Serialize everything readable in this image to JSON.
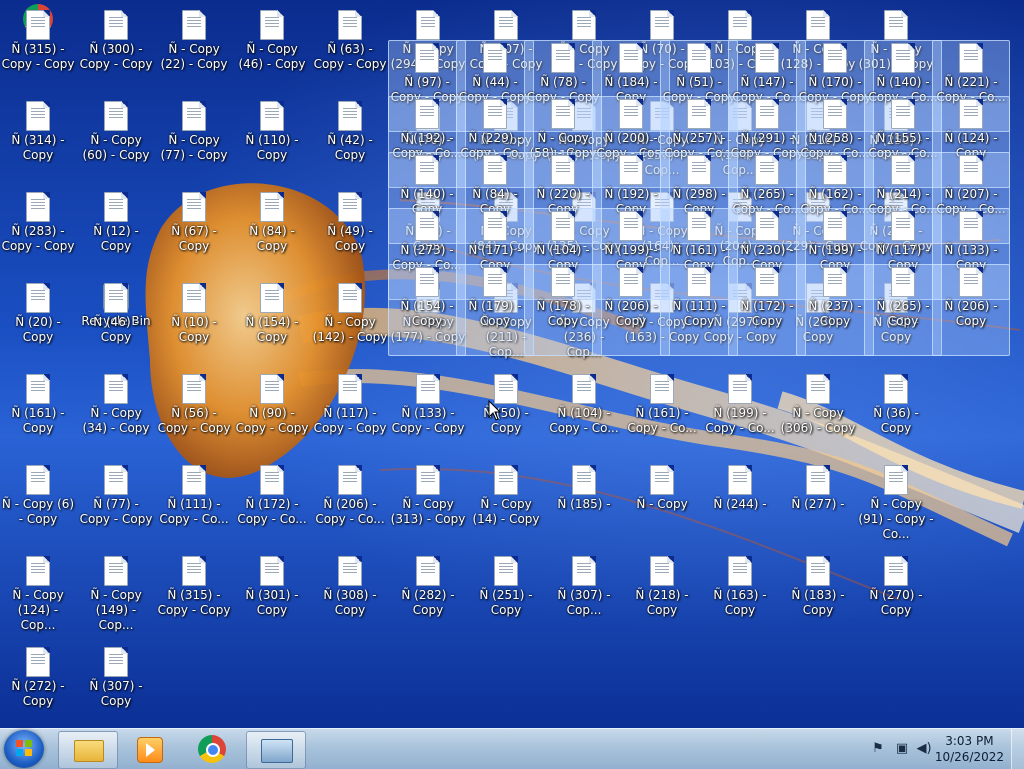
{
  "desktop": {
    "recycle_bin_label": "Recycle Bin",
    "selected_icons": [
      "Ñ (97) - Copy - Copy",
      "Ñ (44) - Copy - Copy",
      "Ñ (78) - Copy - Copy",
      "Ñ (184) - Copy",
      "Ñ (51) - Copy - Copy",
      "Ñ (147) - Copy - Co...",
      "Ñ (170) - Copy - Copy",
      "Ñ (140) - Copy - Co...",
      "Ñ (221) - Copy - Co...",
      "Ñ (192) - Copy - Co...",
      "Ñ (229) - Copy - Co...",
      "Ñ - Copy (58) - Copy",
      "Ñ (200) - Copy - Co...",
      "Ñ (257) - Copy - Co...",
      "Ñ (291) - Copy - Copy",
      "Ñ (258) - Copy - Co...",
      "Ñ (155) - Copy - Co...",
      "Ñ (124) - Copy",
      "Ñ (140) - Copy",
      "Ñ (84) - Copy",
      "Ñ (220) - Copy",
      "Ñ (192) - Copy",
      "Ñ (298) - Copy",
      "Ñ (265) - Copy - Co...",
      "Ñ (162) - Copy - Co...",
      "Ñ (214) - Copy - Co...",
      "Ñ (207) - Copy - Co...",
      "Ñ (273) - Copy - Co...",
      "Ñ (171) - Copy",
      "Ñ (104) - Copy",
      "Ñ (199) - Copy",
      "Ñ (161) - Copy",
      "Ñ (230) - Copy",
      "Ñ (199) - Copy",
      "Ñ (117) - Copy",
      "Ñ (133) - Copy",
      "Ñ (154) - Copy",
      "Ñ (179) - Copy",
      "Ñ (178) - Copy",
      "Ñ (206) - Copy",
      "Ñ (111) - Copy",
      "Ñ (172) - Copy",
      "Ñ (237) - Copy",
      "Ñ (265) - Copy",
      "Ñ (206) - Copy"
    ],
    "icons": [
      "Ñ (315) - Copy - Copy",
      "Ñ (300) - Copy - Copy",
      "Ñ - Copy (22) - Copy",
      "Ñ - Copy (46) - Copy",
      "Ñ (63) - Copy - Copy",
      "Ñ - Copy (294) - Copy",
      "Ñ (307) - Copy - Copy",
      "Ñ - Copy (53) - Copy",
      "Ñ (70) - Copy - Copy",
      "Ñ - Copy (103) - Copy",
      "Ñ - Copy (128) - Copy",
      "Ñ - Copy (301) - Copy",
      "Ñ (314) - Copy",
      "Ñ - Copy (60) - Copy",
      "Ñ - Copy (77) - Copy",
      "Ñ (110) - Copy",
      "Ñ (42) - Copy",
      "Ñ (76) - Copy",
      "Ñ - Copy (77) - Copy",
      "Ñ - Copy (117) - Copy",
      "Ñ - Copy (157) - Cop...",
      "Ñ - Copy (184) - Cop...",
      "Ñ (216) - Copy",
      "Ñ (250) - Copy",
      "Ñ (283) - Copy - Copy",
      "Ñ (12) - Copy",
      "Ñ (67) - Copy",
      "Ñ (84) - Copy",
      "Ñ (49) - Copy",
      "Ñ (83) - Copy",
      "Ñ - Copy (84) - Copy",
      "Ñ - Copy (135) - Copy",
      "Ñ - Copy (164) - Cop...",
      "Ñ - Copy (204) - Cop...",
      "Ñ - Copy (229) - Copy",
      "Ñ (290) - Copy - Copy",
      "Ñ (20) - Copy",
      "Ñ (46) - Copy",
      "Ñ (10) - Copy",
      "Ñ (154) - Copy",
      "Ñ - Copy (142) - Copy",
      "Ñ - Copy (177) - Copy",
      "Ñ - Copy (211) - Cop...",
      "Ñ - Copy (236) - Cop...",
      "Ñ - Copy (163) - Copy",
      "Ñ (297) - Copy - Copy",
      "Ñ (28) - Copy",
      "Ñ (51) - Copy",
      "Ñ (161) - Copy",
      "Ñ - Copy (34) - Copy",
      "Ñ (56) - Copy - Copy",
      "Ñ (90) - Copy - Copy",
      "Ñ (117) - Copy - Copy",
      "Ñ (133) - Copy - Copy",
      "Ñ (50) - Copy",
      "Ñ (104) - Copy - Co...",
      "Ñ (161) - Copy - Co...",
      "Ñ (199) - Copy - Co...",
      "Ñ - Copy (306) - Copy",
      "Ñ (36) - Copy",
      "Ñ - Copy (6) - Copy",
      "Ñ (77) - Copy - Copy",
      "Ñ (111) - Copy - Co...",
      "Ñ (172) - Copy - Co...",
      "Ñ (206) - Copy - Co...",
      "Ñ - Copy (313) - Copy",
      "Ñ - Copy (14) - Copy",
      "Ñ (185) -",
      "Ñ - Copy",
      "Ñ (244) -",
      "Ñ (277) -",
      "Ñ - Copy (91) - Copy - Co...",
      "Ñ - Copy (124) - Cop...",
      "Ñ - Copy (149) - Cop...",
      "Ñ (315) - Copy - Copy",
      "Ñ (301) - Copy",
      "Ñ (308) - Copy",
      "Ñ (282) - Copy",
      "Ñ (251) - Copy",
      "Ñ (307) - Cop...",
      "Ñ (218) - Copy",
      "Ñ (163) - Copy",
      "Ñ (183) - Copy",
      "Ñ (270) - Copy",
      "Ñ (272) - Copy",
      "Ñ (307) - Copy"
    ]
  },
  "taskbar": {
    "start_label": "Start",
    "pinned": [
      "Windows Explorer",
      "Windows Media Player",
      "Google Chrome",
      "Remote Desktop"
    ],
    "clock_time": "3:03 PM",
    "clock_date": "10/26/2022"
  },
  "colors": {
    "wallpaper_top": "#0b2c8e",
    "wallpaper_mid": "#2a63d6",
    "taskbar": "#a6c1da",
    "selection": "#b4d2ff",
    "jellyfish": "#e8922a"
  }
}
